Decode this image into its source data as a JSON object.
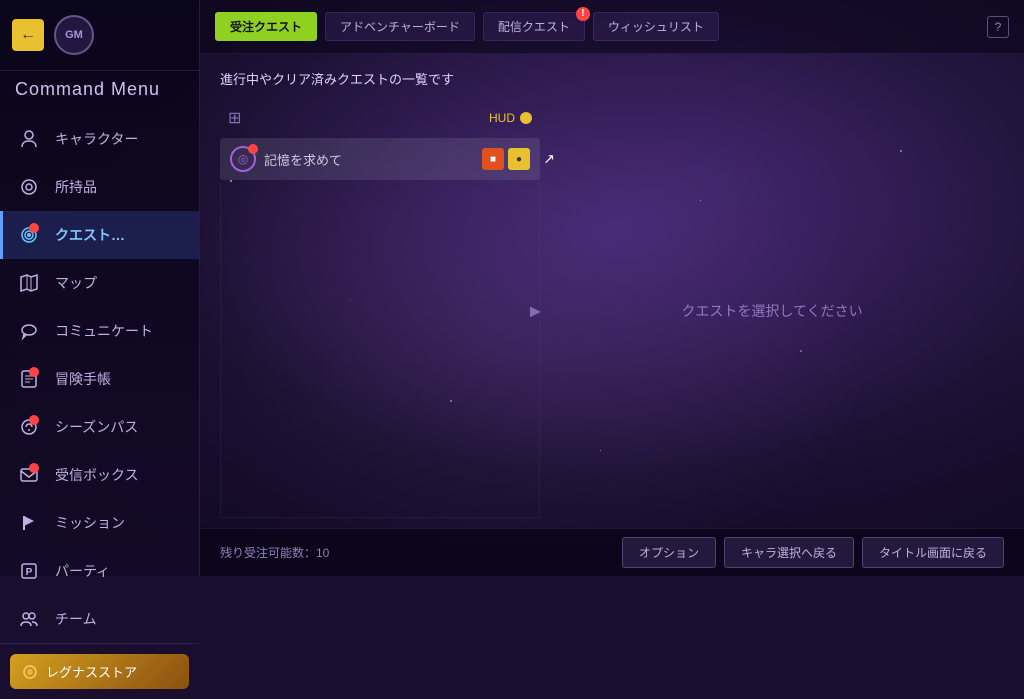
{
  "app": {
    "title": "Command Menu"
  },
  "sidebar": {
    "back_label": "←",
    "logo_text": "GM",
    "items": [
      {
        "id": "character",
        "label": "キャラクター",
        "icon": "👤",
        "badge": false,
        "active": false
      },
      {
        "id": "inventory",
        "label": "所持品",
        "icon": "🎒",
        "badge": false,
        "active": false
      },
      {
        "id": "quest",
        "label": "クエスト…",
        "icon": "🔵",
        "badge": true,
        "active": true
      },
      {
        "id": "map",
        "label": "マップ",
        "icon": "🗺",
        "badge": false,
        "active": false
      },
      {
        "id": "communicate",
        "label": "コミュニケート",
        "icon": "💬",
        "badge": false,
        "active": false
      },
      {
        "id": "adventure",
        "label": "冒険手帳",
        "icon": "📖",
        "badge": true,
        "active": false
      },
      {
        "id": "season",
        "label": "シーズンパス",
        "icon": "⚙",
        "badge": true,
        "active": false
      },
      {
        "id": "inbox",
        "label": "受信ボックス",
        "icon": "✉",
        "badge": true,
        "active": false
      },
      {
        "id": "mission",
        "label": "ミッション",
        "icon": "✏",
        "badge": false,
        "active": false
      },
      {
        "id": "party",
        "label": "パーティ",
        "icon": "🅿",
        "badge": false,
        "active": false
      },
      {
        "id": "team",
        "label": "チーム",
        "icon": "👥",
        "badge": false,
        "active": false
      }
    ],
    "store": {
      "label": "レグナスストア"
    }
  },
  "tabs": [
    {
      "id": "active-quests",
      "label": "受注クエスト",
      "active": true,
      "badge": false
    },
    {
      "id": "adventure-board",
      "label": "アドベンチャーボード",
      "active": false,
      "badge": false
    },
    {
      "id": "delivery-quests",
      "label": "配信クエスト",
      "active": false,
      "badge": true
    },
    {
      "id": "wishlist",
      "label": "ウィッシュリスト",
      "active": false,
      "badge": false
    }
  ],
  "main": {
    "subtitle": "進行中やクリア済みクエストの一覧です",
    "hud_label": "HUD",
    "quest_items": [
      {
        "id": "q1",
        "name": "記憶を求めて",
        "has_badge": true
      }
    ],
    "detail_placeholder": "クエストを選択してください",
    "footer": {
      "count_label": "残り受注可能数：10",
      "buttons": [
        {
          "id": "option",
          "label": "オプション"
        },
        {
          "id": "char-select",
          "label": "キャラ選択へ戻る"
        },
        {
          "id": "title",
          "label": "タイトル画面に戻る"
        }
      ]
    }
  },
  "icons": {
    "back": "←",
    "grid": "⊞",
    "square_btn": "■",
    "circle_btn": "●",
    "chevron_right": "▶",
    "help": "?"
  }
}
